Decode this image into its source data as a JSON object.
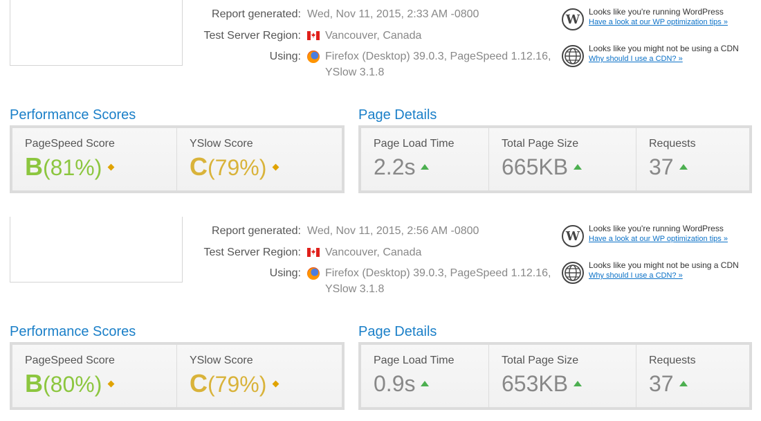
{
  "reports": [
    {
      "meta": {
        "generated_label": "Report generated:",
        "generated_value": "Wed, Nov 11, 2015, 2:33 AM -0800",
        "region_label": "Test Server Region:",
        "region_value": "Vancouver, Canada",
        "using_label": "Using:",
        "using_line1": "Firefox (Desktop) 39.0.3, PageSpeed 1.12.16,",
        "using_line2": "YSlow 3.1.8",
        "region_icon": "canada-flag-icon",
        "browser_icon": "firefox-icon"
      },
      "hints": [
        {
          "icon": "wordpress-icon",
          "title": "Looks like you're running WordPress",
          "link": "Have a look at our WP optimization tips »"
        },
        {
          "icon": "globe-icon",
          "title": "Looks like you might not be using a CDN",
          "link": "Why should I use a CDN? »"
        }
      ],
      "scores": {
        "title": "Performance Scores",
        "pagespeed_label": "PageSpeed Score",
        "pagespeed_grade": "B",
        "pagespeed_pct": "(81%)",
        "yslow_label": "YSlow Score",
        "yslow_grade": "C",
        "yslow_pct": "(79%)"
      },
      "details": {
        "title": "Page Details",
        "load_label": "Page Load Time",
        "load_value": "2.2s",
        "size_label": "Total Page Size",
        "size_value": "665KB",
        "requests_label": "Requests",
        "requests_value": "37"
      }
    },
    {
      "meta": {
        "generated_label": "Report generated:",
        "generated_value": "Wed, Nov 11, 2015, 2:56 AM -0800",
        "region_label": "Test Server Region:",
        "region_value": "Vancouver, Canada",
        "using_label": "Using:",
        "using_line1": "Firefox (Desktop) 39.0.3, PageSpeed 1.12.16,",
        "using_line2": "YSlow 3.1.8",
        "region_icon": "canada-flag-icon",
        "browser_icon": "firefox-icon"
      },
      "hints": [
        {
          "icon": "wordpress-icon",
          "title": "Looks like you're running WordPress",
          "link": "Have a look at our WP optimization tips »"
        },
        {
          "icon": "globe-icon",
          "title": "Looks like you might not be using a CDN",
          "link": "Why should I use a CDN? »"
        }
      ],
      "scores": {
        "title": "Performance Scores",
        "pagespeed_label": "PageSpeed Score",
        "pagespeed_grade": "B",
        "pagespeed_pct": "(80%)",
        "yslow_label": "YSlow Score",
        "yslow_grade": "C",
        "yslow_pct": "(79%)"
      },
      "details": {
        "title": "Page Details",
        "load_label": "Page Load Time",
        "load_value": "0.9s",
        "size_label": "Total Page Size",
        "size_value": "653KB",
        "requests_label": "Requests",
        "requests_value": "37"
      }
    }
  ],
  "colors": {
    "accent": "#1a7fc8",
    "grade_b": "#8cc63f",
    "grade_c": "#d9b33a",
    "link": "#0b71c7",
    "up_arrow": "#4caf50"
  }
}
